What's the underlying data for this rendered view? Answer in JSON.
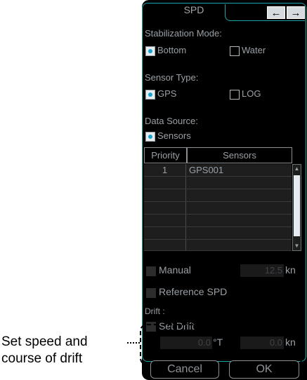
{
  "window": {
    "title": "SPD"
  },
  "nav": {
    "back_icon": "left-arrow-icon",
    "forward_icon": "right-arrow-icon",
    "back_glyph": "←",
    "forward_glyph": "→"
  },
  "stabilization": {
    "label": "Stabilization Mode:",
    "options": [
      {
        "label": "Bottom",
        "selected": true
      },
      {
        "label": "Water",
        "selected": false
      }
    ]
  },
  "sensor_type": {
    "label": "Sensor Type:",
    "options": [
      {
        "label": "GPS",
        "selected": true
      },
      {
        "label": "LOG",
        "selected": false
      }
    ]
  },
  "data_source": {
    "label": "Data Source:",
    "options": [
      {
        "label": "Sensors",
        "selected": true
      }
    ]
  },
  "sensor_table": {
    "headers": [
      "Priority",
      "Sensors"
    ],
    "rows": [
      {
        "priority": "1",
        "sensor": "GPS001"
      }
    ]
  },
  "manual": {
    "label": "Manual",
    "value": "12.5",
    "unit": "kn"
  },
  "reference_spd": {
    "label": "Reference SPD"
  },
  "drift": {
    "label": "Drift :",
    "set_drift_label": "Set Drift",
    "course_value": "0.0",
    "course_unit": "°T",
    "speed_value": "0.0",
    "speed_unit": "kn"
  },
  "annotation": {
    "line1": "Set speed and",
    "line2": "course of drift"
  },
  "buttons": {
    "cancel": "Cancel",
    "ok": "OK"
  },
  "colors": {
    "frame": "#1aa6a6",
    "radio_dot": "#17a3cf",
    "text": "#9aa0a5"
  }
}
